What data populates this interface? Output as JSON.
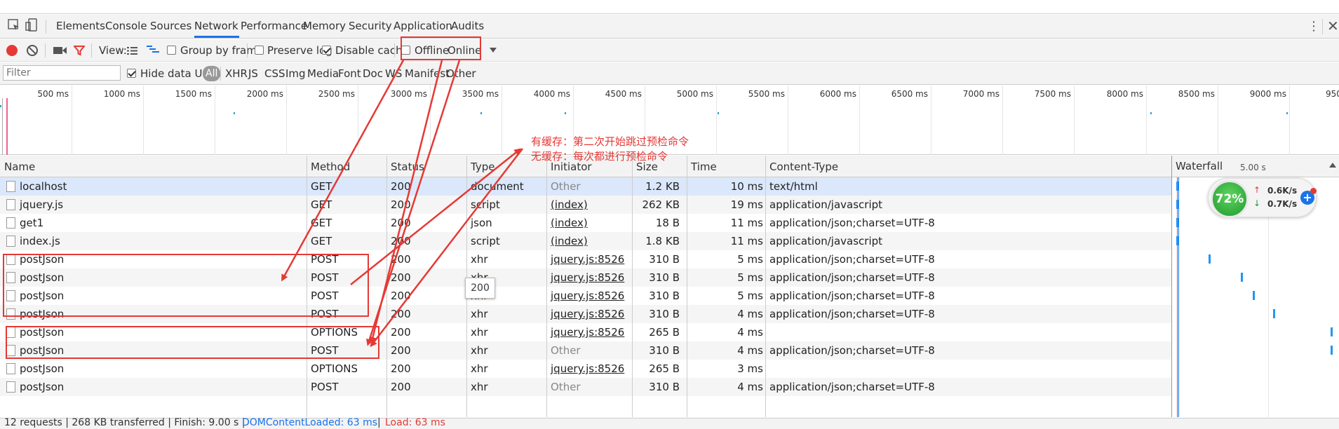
{
  "tabs": [
    "Elements",
    "Console",
    "Sources",
    "Network",
    "Performance",
    "Memory",
    "Security",
    "Application",
    "Audits"
  ],
  "toolbar": {
    "view_label": "View:",
    "group_by_frame": "Group by frame",
    "preserve_log": "Preserve log",
    "disable_cache": "Disable cache",
    "offline": "Offline",
    "throttle": "Online"
  },
  "filterbar": {
    "placeholder": "Filter",
    "hide_data_urls": "Hide data URLs",
    "types": [
      "All",
      "XHR",
      "JS",
      "CSS",
      "Img",
      "Media",
      "Font",
      "Doc",
      "WS",
      "Manifest",
      "Other"
    ]
  },
  "overview_ticks": [
    "500 ms",
    "1000 ms",
    "1500 ms",
    "2000 ms",
    "2500 ms",
    "3000 ms",
    "3500 ms",
    "4000 ms",
    "4500 ms",
    "5000 ms",
    "5500 ms",
    "6000 ms",
    "6500 ms",
    "7000 ms",
    "7500 ms",
    "8000 ms",
    "8500 ms",
    "9000 ms",
    "950"
  ],
  "columns": {
    "name": "Name",
    "method": "Method",
    "status": "Status",
    "type": "Type",
    "initiator": "Initiator",
    "size": "Size",
    "time": "Time",
    "content_type": "Content-Type",
    "waterfall": "Waterfall",
    "waterfall_scale": "5.00 s"
  },
  "rows": [
    {
      "name": "localhost",
      "method": "GET",
      "status": "200",
      "type": "document",
      "initiator": "Other",
      "size": "1.2 KB",
      "time": "10 ms",
      "content_type": "text/html"
    },
    {
      "name": "jquery.js",
      "method": "GET",
      "status": "200",
      "type": "script",
      "initiator": "(index)",
      "size": "262 KB",
      "time": "19 ms",
      "content_type": "application/javascript"
    },
    {
      "name": "get1",
      "method": "GET",
      "status": "200",
      "type": "json",
      "initiator": "(index)",
      "size": "18 B",
      "time": "11 ms",
      "content_type": "application/json;charset=UTF-8"
    },
    {
      "name": "index.js",
      "method": "GET",
      "status": "200",
      "type": "script",
      "initiator": "(index)",
      "size": "1.8 KB",
      "time": "11 ms",
      "content_type": "application/javascript"
    },
    {
      "name": "postJson",
      "method": "POST",
      "status": "200",
      "type": "xhr",
      "initiator": "jquery.js:8526",
      "size": "310 B",
      "time": "5 ms",
      "content_type": "application/json;charset=UTF-8"
    },
    {
      "name": "postJson",
      "method": "POST",
      "status": "200",
      "type": "xhr",
      "initiator": "jquery.js:8526",
      "size": "310 B",
      "time": "5 ms",
      "content_type": "application/json;charset=UTF-8"
    },
    {
      "name": "postJson",
      "method": "POST",
      "status": "200",
      "type": "xhr",
      "initiator": "jquery.js:8526",
      "size": "310 B",
      "time": "5 ms",
      "content_type": "application/json;charset=UTF-8"
    },
    {
      "name": "postJson",
      "method": "POST",
      "status": "200",
      "type": "xhr",
      "initiator": "jquery.js:8526",
      "size": "310 B",
      "time": "4 ms",
      "content_type": "application/json;charset=UTF-8"
    },
    {
      "name": "postJson",
      "method": "OPTIONS",
      "status": "200",
      "type": "xhr",
      "initiator": "jquery.js:8526",
      "size": "265 B",
      "time": "4 ms",
      "content_type": ""
    },
    {
      "name": "postJson",
      "method": "POST",
      "status": "200",
      "type": "xhr",
      "initiator": "Other",
      "size": "310 B",
      "time": "4 ms",
      "content_type": "application/json;charset=UTF-8"
    },
    {
      "name": "postJson",
      "method": "OPTIONS",
      "status": "200",
      "type": "xhr",
      "initiator": "jquery.js:8526",
      "size": "265 B",
      "time": "3 ms",
      "content_type": ""
    },
    {
      "name": "postJson",
      "method": "POST",
      "status": "200",
      "type": "xhr",
      "initiator": "Other",
      "size": "310 B",
      "time": "4 ms",
      "content_type": "application/json;charset=UTF-8"
    }
  ],
  "tooltip": "200",
  "annotation": {
    "line1": "有缓存：第二次开始跳过预检命令",
    "line2": "无缓存：每次都进行预检命令"
  },
  "widget": {
    "percent": "72%",
    "up": "0.6K/s",
    "down": "0.7K/s"
  },
  "status": {
    "summary": "12 requests | 268 KB transferred | Finish: 9.00 s |",
    "dom": "DOMContentLoaded: 63 ms",
    "sep": "|",
    "load": "Load: 63 ms"
  },
  "colors": {
    "accent": "#1a73e8",
    "annotation": "#e53935",
    "record": "#e53935"
  }
}
